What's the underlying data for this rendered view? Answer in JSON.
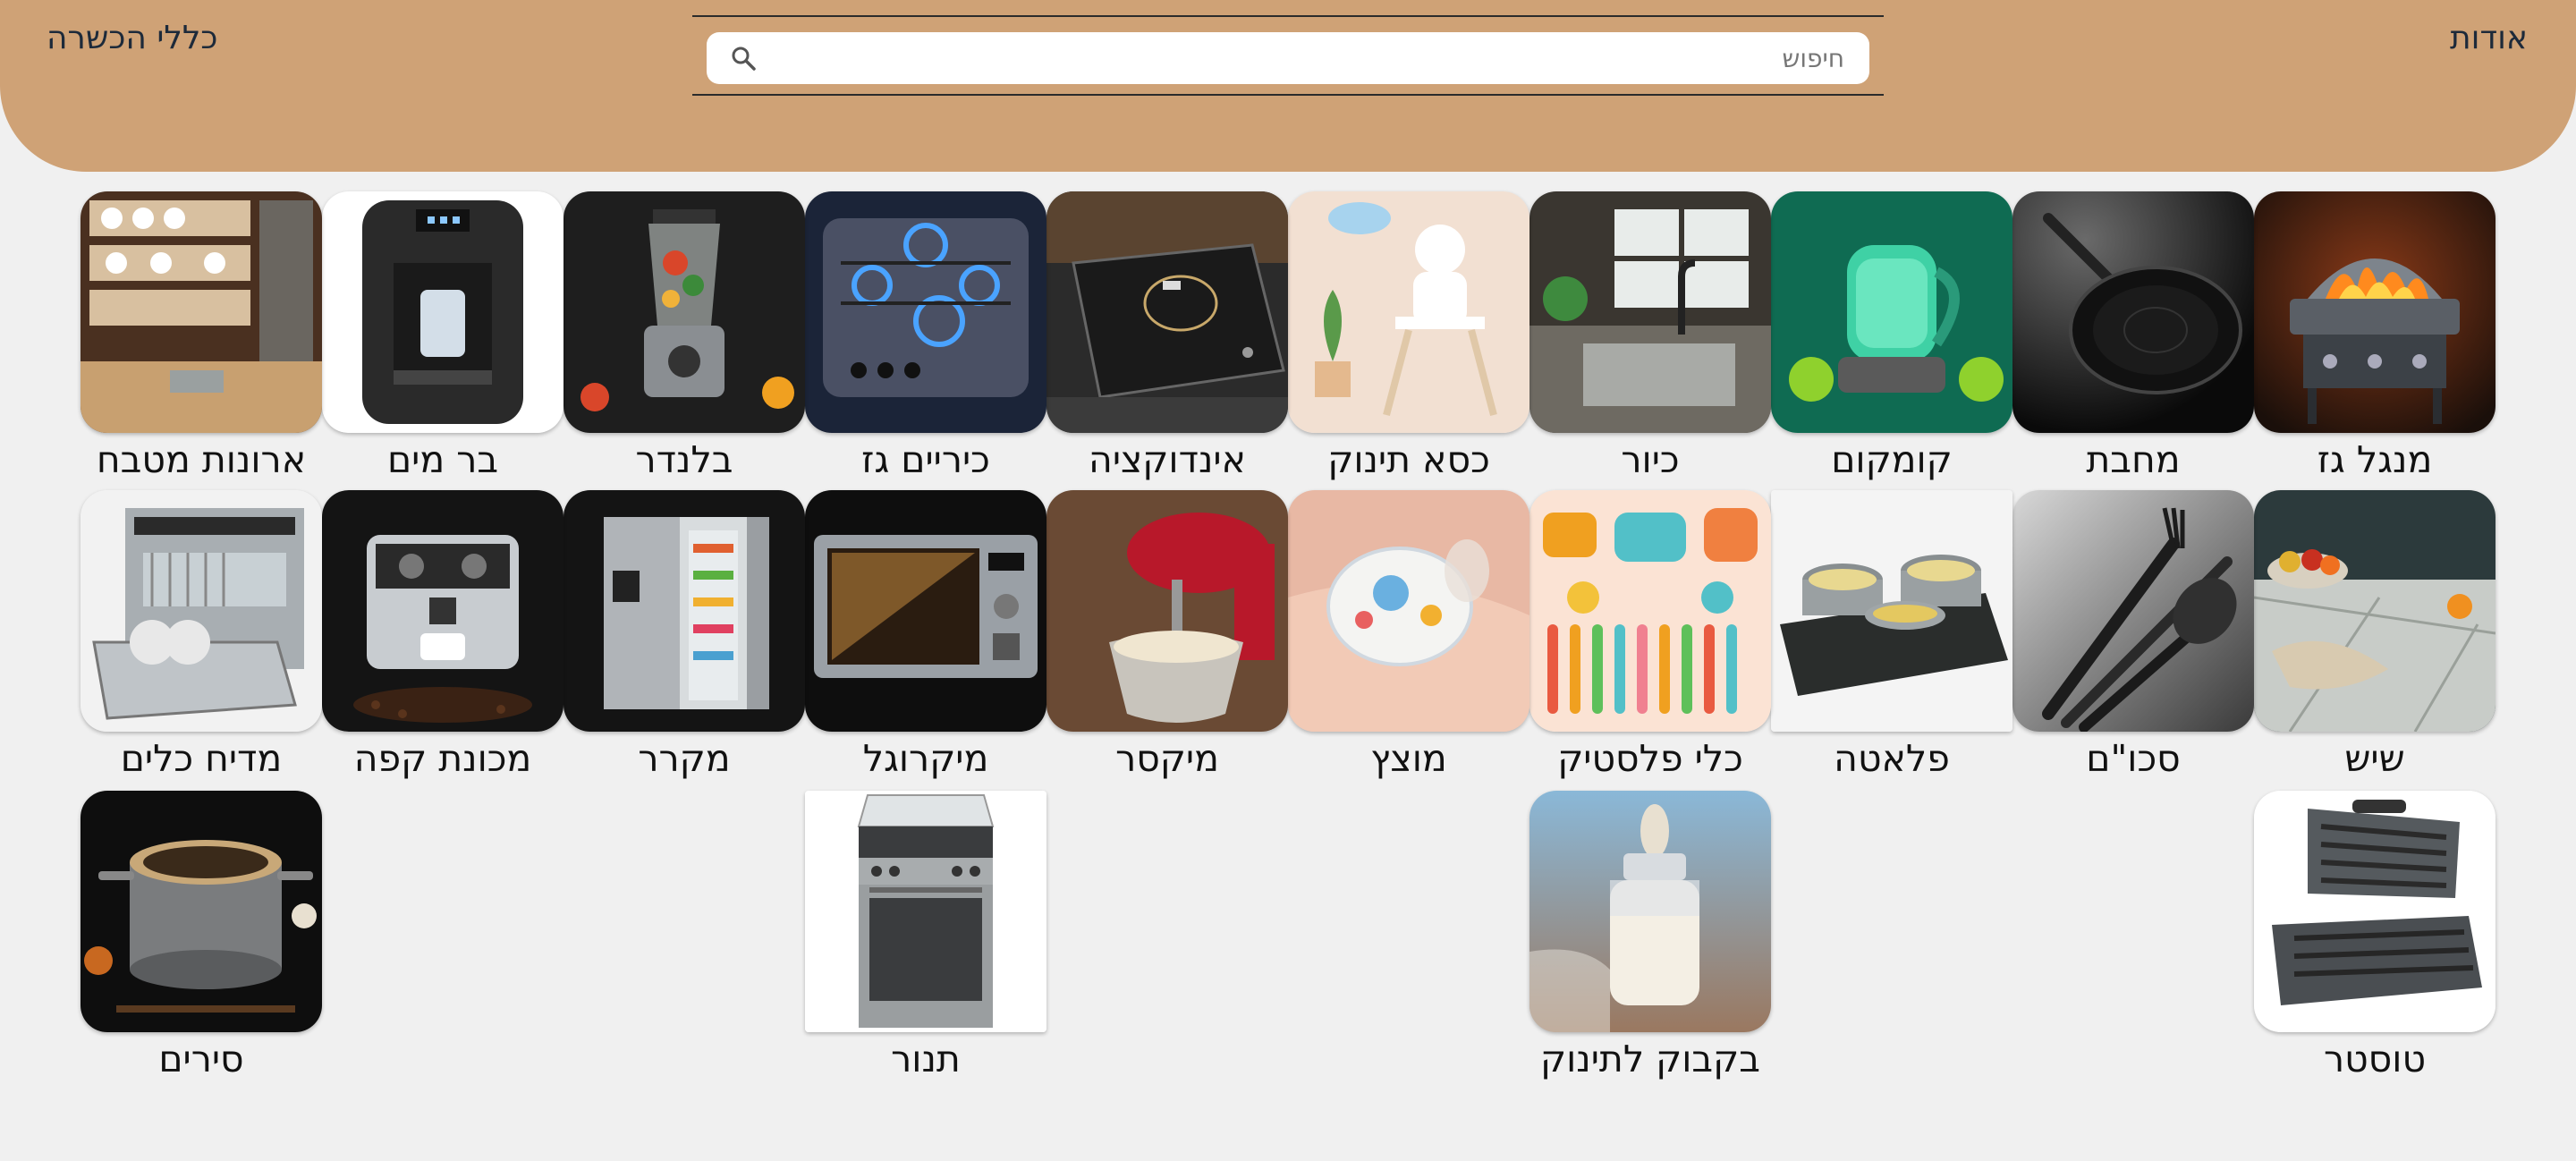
{
  "header": {
    "about_label": "אודות",
    "rules_label": "כללי הכשרה"
  },
  "search": {
    "placeholder": "חיפוש"
  },
  "colors": {
    "header_bg": "#cfa276",
    "page_bg": "#f0f0f0",
    "text": "#1d2a3a"
  },
  "categories": [
    {
      "label": "מנגל גז",
      "icon": "gas-grill"
    },
    {
      "label": "מחבת",
      "icon": "frying-pan"
    },
    {
      "label": "קומקום",
      "icon": "kettle"
    },
    {
      "label": "כיור",
      "icon": "sink"
    },
    {
      "label": "כסא תינוק",
      "icon": "high-chair"
    },
    {
      "label": "אינדוקציה",
      "icon": "induction-cooktop"
    },
    {
      "label": "כיריים גז",
      "icon": "gas-stove"
    },
    {
      "label": "בלנדר",
      "icon": "blender"
    },
    {
      "label": "בר מים",
      "icon": "water-dispenser"
    },
    {
      "label": "ארונות מטבח",
      "icon": "kitchen-cabinets"
    },
    {
      "label": "שיש",
      "icon": "countertop"
    },
    {
      "label": "סכו\"ם",
      "icon": "cutlery"
    },
    {
      "label": "פלאטה",
      "icon": "hot-plate"
    },
    {
      "label": "כלי פלסטיק",
      "icon": "plastic-utensils"
    },
    {
      "label": "מוצץ",
      "icon": "pacifier"
    },
    {
      "label": "מיקסר",
      "icon": "stand-mixer"
    },
    {
      "label": "מיקרוגל",
      "icon": "microwave"
    },
    {
      "label": "מקרר",
      "icon": "refrigerator"
    },
    {
      "label": "מכונת קפה",
      "icon": "coffee-machine"
    },
    {
      "label": "מדיח כלים",
      "icon": "dishwasher"
    },
    {
      "label": "טוסטר",
      "icon": "sandwich-toaster"
    },
    {
      "label": "בקבוק לתינוק",
      "icon": "baby-bottle"
    },
    {
      "label": "תנור",
      "icon": "oven"
    },
    {
      "label": "סירים",
      "icon": "cooking-pot"
    }
  ]
}
